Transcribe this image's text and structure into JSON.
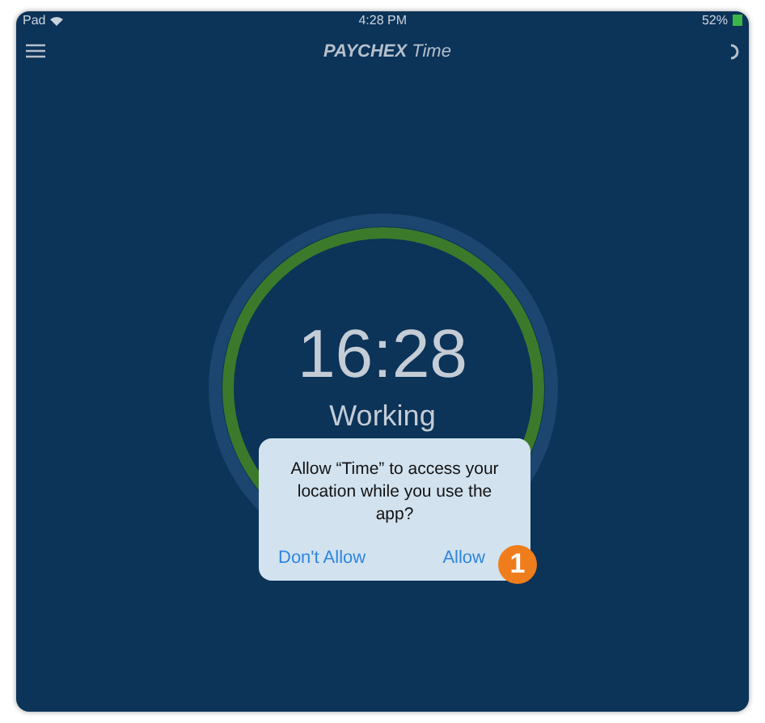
{
  "status_bar": {
    "carrier": "Pad",
    "time": "4:28 PM",
    "battery": "52%"
  },
  "nav_bar": {
    "brand": "PAYCHEX",
    "title": "Time"
  },
  "clock": {
    "time": "16:28",
    "status": "Working"
  },
  "alert": {
    "message": "Allow “Time” to access your location while you use the app?",
    "buttons": [
      "Don't Allow",
      "Allow"
    ]
  },
  "callout": {
    "number": "1"
  }
}
